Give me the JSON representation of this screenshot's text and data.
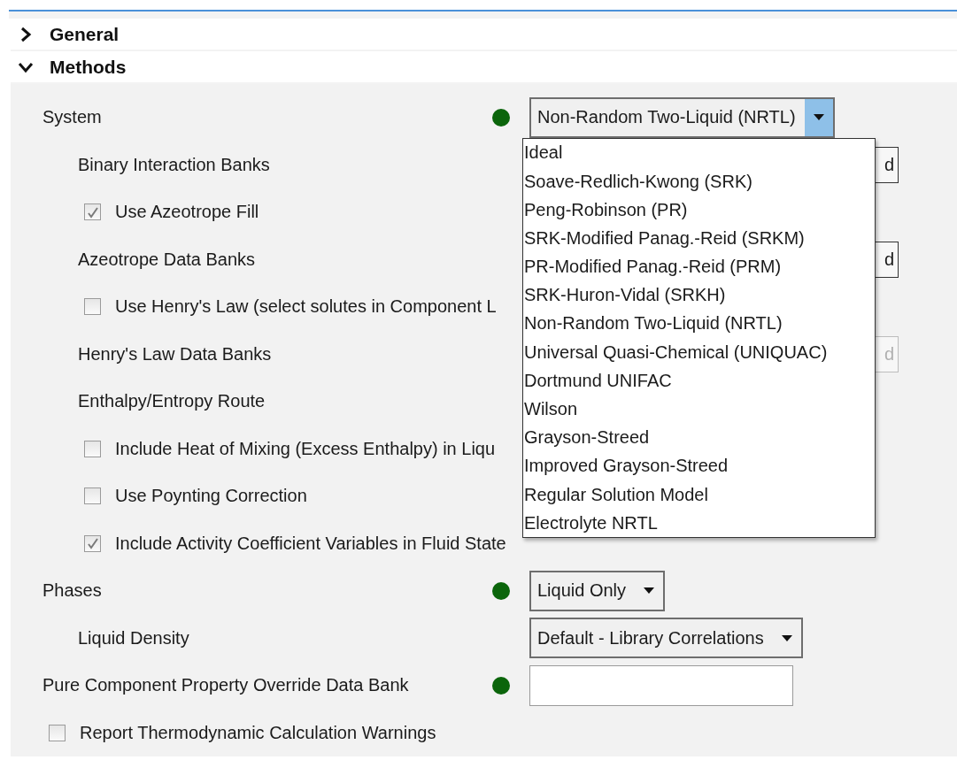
{
  "sections": [
    {
      "label": "General",
      "expanded": false
    },
    {
      "label": "Methods",
      "expanded": true,
      "rows": [
        {
          "kind": "text",
          "label": "System",
          "status_dot": true,
          "control": {
            "kind": "dropdown",
            "value": "Non-Random Two-Liquid (NRTL)",
            "open": true,
            "options": [
              "Ideal",
              "Soave-Redlich-Kwong (SRK)",
              "Peng-Robinson (PR)",
              "SRK-Modified Panag.-Reid (SRKM)",
              "PR-Modified Panag.-Reid (PRM)",
              "SRK-Huron-Vidal (SRKH)",
              "Non-Random Two-Liquid (NRTL)",
              "Universal Quasi-Chemical (UNIQUAC)",
              "Dortmund UNIFAC",
              "Wilson",
              "Grayson-Streed",
              "Improved Grayson-Streed",
              "Regular Solution Model",
              "Electrolyte NRTL"
            ]
          },
          "children": [
            {
              "kind": "text",
              "label": "Binary Interaction Banks",
              "status_dot": false,
              "control": {
                "kind": "button",
                "label": "d",
                "disabled": false
              }
            },
            {
              "kind": "check",
              "label": "Use Azeotrope Fill",
              "checked": true
            },
            {
              "kind": "text",
              "label": "Azeotrope Data Banks",
              "status_dot": false,
              "control": {
                "kind": "button",
                "label": "d",
                "disabled": false
              }
            },
            {
              "kind": "check",
              "label": "Use Henry's Law (select solutes in Component L",
              "checked": false
            },
            {
              "kind": "text",
              "label": "Henry's Law Data Banks",
              "status_dot": false,
              "control": {
                "kind": "button",
                "label": "d",
                "disabled": true
              }
            },
            {
              "kind": "text",
              "label": "Enthalpy/Entropy Route",
              "status_dot": false
            },
            {
              "kind": "check",
              "label": "Include Heat of Mixing (Excess Enthalpy) in Liqu",
              "checked": false
            },
            {
              "kind": "check",
              "label": "Use Poynting Correction",
              "checked": false
            },
            {
              "kind": "check",
              "label": "Include Activity Coefficient Variables in Fluid State",
              "checked": true
            }
          ]
        },
        {
          "kind": "text",
          "label": "Phases",
          "status_dot": true,
          "control": {
            "kind": "dropdown",
            "value": "Liquid Only",
            "open": false
          },
          "children": [
            {
              "kind": "text",
              "label": "Liquid Density",
              "status_dot": false,
              "control": {
                "kind": "dropdown",
                "value": "Default - Library Correlations",
                "open": false
              }
            }
          ]
        },
        {
          "kind": "text",
          "label": "Pure Component Property Override Data Bank",
          "status_dot": true,
          "control": {
            "kind": "field"
          }
        },
        {
          "kind": "check",
          "label": "Report Thermodynamic Calculation Warnings",
          "checked": false
        }
      ]
    }
  ]
}
